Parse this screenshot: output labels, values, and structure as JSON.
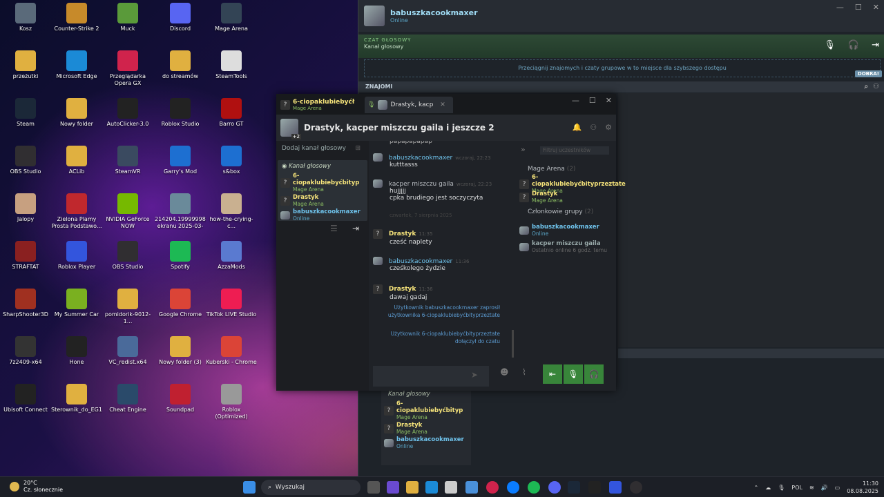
{
  "desktop_icons": [
    {
      "label": "Kosz",
      "color": "#5a6a7a"
    },
    {
      "label": "Counter-Strike 2",
      "color": "#c78a2a"
    },
    {
      "label": "Muck",
      "color": "#5a9a3a"
    },
    {
      "label": "Discord",
      "color": "#5865f2"
    },
    {
      "label": "Mage Arena",
      "color": "#334455"
    },
    {
      "label": "przeżutki",
      "color": "#e0b040"
    },
    {
      "label": "Microsoft Edge",
      "color": "#1b8ad6"
    },
    {
      "label": "Przeglądarka Opera GX",
      "color": "#d0234c"
    },
    {
      "label": "do streamów",
      "color": "#e0b040"
    },
    {
      "label": "SteamTools",
      "color": "#ddd"
    },
    {
      "label": "Steam",
      "color": "#1b2838"
    },
    {
      "label": "Nowy folder",
      "color": "#e0b040"
    },
    {
      "label": "AutoClicker-3.0",
      "color": "#222"
    },
    {
      "label": "Roblox Studio",
      "color": "#222"
    },
    {
      "label": "Barro GT",
      "color": "#b01010"
    },
    {
      "label": "OBS Studio",
      "color": "#302e31"
    },
    {
      "label": "ACLib",
      "color": "#e0b040"
    },
    {
      "label": "SteamVR",
      "color": "#3a4a60"
    },
    {
      "label": "Garry's Mod",
      "color": "#1d6fd1"
    },
    {
      "label": "s&box",
      "color": "#1d6fd1"
    },
    {
      "label": "Jalopy",
      "color": "#c7a080"
    },
    {
      "label": "Zielona Plamy Prosta Podstawo...",
      "color": "#c0282d"
    },
    {
      "label": "NVIDIA GeForce NOW",
      "color": "#76b900"
    },
    {
      "label": "214204.199999988... ekranu 2025-03-2...",
      "color": "#6a8a9a"
    },
    {
      "label": "how-the-crying-c...",
      "color": "#c9b090"
    },
    {
      "label": "STRAFTAT",
      "color": "#8a2020"
    },
    {
      "label": "Roblox Player",
      "color": "#3355dd"
    },
    {
      "label": "OBS Studio",
      "color": "#302e31"
    },
    {
      "label": "Spotify",
      "color": "#1db954"
    },
    {
      "label": "AzzaMods",
      "color": "#5a7ad0"
    },
    {
      "label": "SharpShooter3D",
      "color": "#a03020"
    },
    {
      "label": "My Summer Car",
      "color": "#7ab020"
    },
    {
      "label": "pomidorik-9012-1...",
      "color": "#e0b040"
    },
    {
      "label": "Google Chrome",
      "color": "#db4437"
    },
    {
      "label": "TikTok LIVE Studio",
      "color": "#ee1d52"
    },
    {
      "label": "7z2409-x64",
      "color": "#333"
    },
    {
      "label": "Hone",
      "color": "#222"
    },
    {
      "label": "VC_redist.x64",
      "color": "#4a6a9a"
    },
    {
      "label": "Nowy folder (3)",
      "color": "#e0b040"
    },
    {
      "label": "Kuberski - Chrome",
      "color": "#db4437"
    },
    {
      "label": "Ubisoft Connect",
      "color": "#222"
    },
    {
      "label": "Sterownik_do_EG1...",
      "color": "#e0b040"
    },
    {
      "label": "Cheat Engine",
      "color": "#2a4a6a"
    },
    {
      "label": "Soundpad",
      "color": "#c02030"
    },
    {
      "label": "Roblox (Optimized)",
      "color": "#999"
    }
  ],
  "steam": {
    "user_name": "babuszkacookmaxer",
    "user_status": "Online",
    "voice_title": "CZAT GŁOSOWY",
    "voice_sub": "Kanał głosowy",
    "dropzone": "Przeciągnij znajomych i czaty grupowe w to miejsce dla szybszego dostępu",
    "dobra": "DOBRA!",
    "friends_header": "ZNAJOMI"
  },
  "chat": {
    "tab1_name": "6-ciopaklubiebyćł",
    "tab1_game": "Mage Arena",
    "tab2_name": "Drastyk, kacp",
    "title": "Drastyk, kacper miszczu gaila i jeszcze 2",
    "avatar_badge": "+2",
    "add_voice": "Dodaj kanał głosowy",
    "voice_channel": "Kanał głosowy",
    "members": [
      {
        "name": "6-ciopaklubiebyćbityp",
        "sub": "Mage Arena",
        "color": "#f5e37a",
        "subcolor": "#8dbf63"
      },
      {
        "name": "Drastyk",
        "sub": "Mage Arena",
        "color": "#f5e37a",
        "subcolor": "#8dbf63"
      },
      {
        "name": "babuszkacookmaxer",
        "sub": "Online",
        "color": "#6fc3ec",
        "subcolor": "#5ba7c9"
      }
    ],
    "messages": [
      {
        "author": "",
        "time": "",
        "text": "papapapapap"
      },
      {
        "author": "babuszkacookmaxer",
        "time": "wczoraj, 22:23",
        "text": "kutttasss",
        "color": "#6fc3ec"
      },
      {
        "author": "kacper miszczu gaila",
        "time": "wczoraj, 22:23",
        "text": "hujjjjj",
        "text2": "cpka brudiego jest soczyczyta",
        "color": "#b9bdc2"
      },
      {
        "author": "Drastyk",
        "time": "11:35",
        "text": "cześć naplety",
        "color": "#f5e37a"
      },
      {
        "author": "babuszkacookmaxer",
        "time": "11:36",
        "text": "cześkolego żydzie",
        "color": "#6fc3ec"
      },
      {
        "author": "Drastyk",
        "time": "11:36",
        "text": "dawaj gadaj",
        "color": "#f5e37a"
      }
    ],
    "date_separator": "czwartek, 7 sierpnia 2025",
    "system_msg1": "Użytkownik babuszkacookmaxer zaprosił użytkownika 6-ciopaklubiebyćbityprzeztate",
    "system_msg2": "Użytkownik 6-ciopaklubiebyćbityprzeztate dołączył do czatu",
    "rp_search": "Filtruj uczestników",
    "rp_group1": "Mage Arena",
    "rp_group1_count": "(2)",
    "rp_group2": "Członkowie grupy",
    "rp_group2_count": "(2)",
    "rp_members": [
      {
        "name": "6-ciopaklubiebyćbityprzeztate",
        "sub": "Mage Arena",
        "color": "#f5e37a",
        "subcolor": "#8dbf63"
      },
      {
        "name": "Drastyk",
        "sub": "Mage Arena",
        "color": "#f5e37a",
        "subcolor": "#8dbf63"
      },
      {
        "name": "babuszkacookmaxer",
        "sub": "Online",
        "color": "#6fc3ec",
        "subcolor": "#5ba7c9"
      },
      {
        "name": "kacper miszczu gaila",
        "sub": "Ostatnio online 6 godz. temu",
        "color": "#9aa",
        "subcolor": "#666"
      }
    ]
  },
  "lower_vc": {
    "title": "Kanał głosowy",
    "members": [
      {
        "name": "6-ciopaklubiebyćbityp",
        "sub": "Mage Arena",
        "color": "#f5e37a",
        "subcolor": "#8dbf63"
      },
      {
        "name": "Drastyk",
        "sub": "Mage Arena",
        "color": "#f5e37a",
        "subcolor": "#8dbf63"
      },
      {
        "name": "babuszkacookmaxer",
        "sub": "Online",
        "color": "#6fc3ec",
        "subcolor": "#5ba7c9"
      }
    ]
  },
  "taskbar": {
    "temp": "20°C",
    "weather": "Cz. słonecznie",
    "search": "Wyszukaj",
    "lang": "POL",
    "time": "11:30",
    "date": "08.08.2025"
  }
}
